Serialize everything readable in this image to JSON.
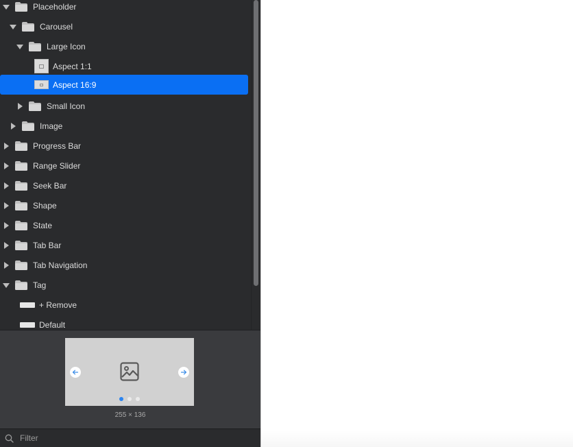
{
  "sidebar": {
    "tree": [
      {
        "label": "Placeholder",
        "kind": "folder",
        "expanded": true
      },
      {
        "label": "Carousel",
        "kind": "folder",
        "expanded": true
      },
      {
        "label": "Large Icon",
        "kind": "folder",
        "expanded": true
      },
      {
        "label": "Aspect 1:1",
        "kind": "symbol"
      },
      {
        "label": "Aspect 16:9",
        "kind": "symbol",
        "selected": true
      },
      {
        "label": "Small Icon",
        "kind": "folder",
        "expanded": false
      },
      {
        "label": "Image",
        "kind": "folder",
        "expanded": false
      },
      {
        "label": "Progress Bar",
        "kind": "folder",
        "expanded": false
      },
      {
        "label": "Range Slider",
        "kind": "folder",
        "expanded": false
      },
      {
        "label": "Seek Bar",
        "kind": "folder",
        "expanded": false
      },
      {
        "label": "Shape",
        "kind": "folder",
        "expanded": false
      },
      {
        "label": "State",
        "kind": "folder",
        "expanded": false
      },
      {
        "label": "Tab Bar",
        "kind": "folder",
        "expanded": false
      },
      {
        "label": "Tab Navigation",
        "kind": "folder",
        "expanded": false
      },
      {
        "label": "Tag",
        "kind": "folder",
        "expanded": true
      },
      {
        "label": "+ Remove",
        "kind": "symbol"
      },
      {
        "label": "Default",
        "kind": "symbol"
      }
    ]
  },
  "preview": {
    "dimensions": "255 × 136",
    "active_dot": 1,
    "dot_count": 3
  },
  "filter": {
    "placeholder": "Filter",
    "value": ""
  },
  "colors": {
    "selection": "#0a6ff3",
    "sidebar_bg": "#2a2b2d",
    "active_dot": "#2a84f0"
  }
}
